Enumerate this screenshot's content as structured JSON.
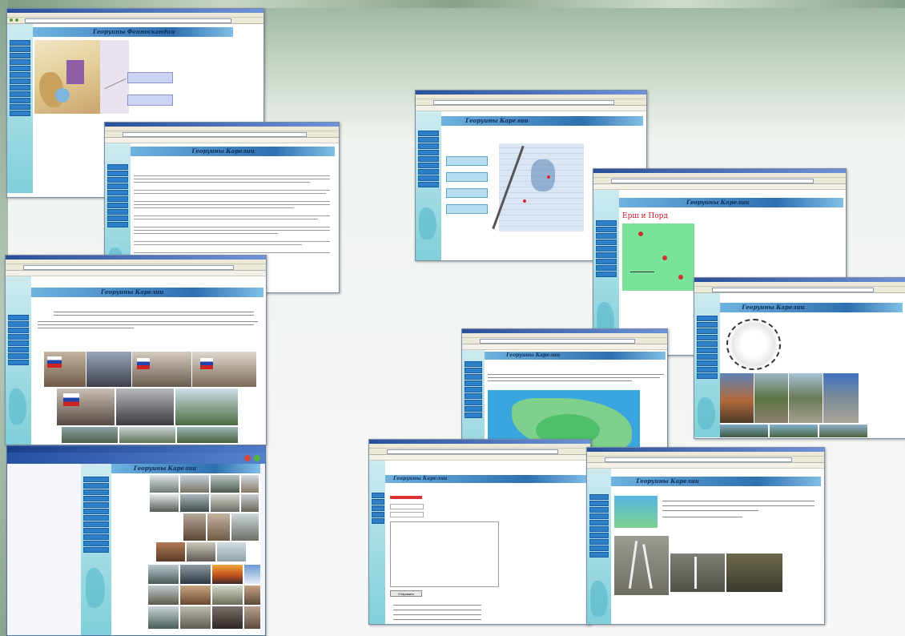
{
  "site_title": "Георуины Карелии",
  "page_titles": [
    "Георуины Фенноскандии",
    "Георуины Карелии",
    "Георуины Карелии",
    "Георуины Карелии",
    "Георуины Карелии"
  ],
  "karelia_red_heading": "Ерш и Порд",
  "submit_label": "Отправить",
  "colors": {
    "banner": "#2f6fb0",
    "nav": "#2e7fc9",
    "sidebar": "#7fcfd9",
    "map_green": "#79e39a",
    "sea": "#3aa6e0"
  }
}
